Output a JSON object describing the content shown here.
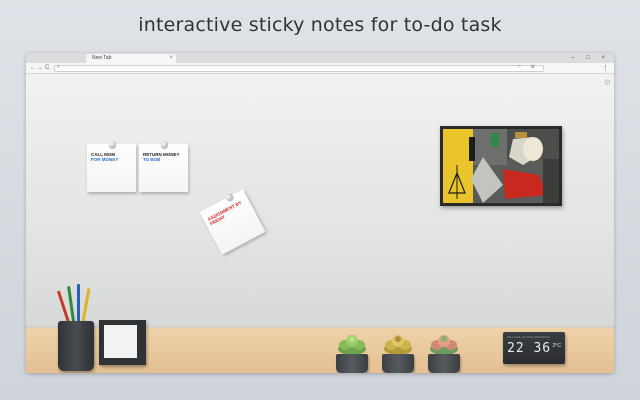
{
  "headline": "interactive sticky notes for to-do task",
  "browser": {
    "tab_title": "New Tab",
    "tab_close": "×",
    "window_controls": "– □ ×",
    "nav_back": "←",
    "nav_forward": "→",
    "nav_reload": "C",
    "omnibox_placeholder": "",
    "omnibox_left_icon": "search-icon",
    "omnibox_right_icons": "☆ ⊕",
    "menu_icon": "⋮"
  },
  "page": {
    "settings_icon": "⚙",
    "notes": [
      {
        "line1": "CALL MOM",
        "line2": "FOR MONEY"
      },
      {
        "line1": "RETURN MONEY",
        "line2": "TO BOB"
      },
      {
        "line1": "ASSIGNMENT BY",
        "line2": "FRIDAY"
      }
    ],
    "clock": {
      "brand": "VILLAGE CLOCK MORNING",
      "time": "22 36",
      "temp": "2°C"
    }
  },
  "colors": {
    "note_accent_blue": "#2a6fc9",
    "note_accent_red": "#dd2222",
    "desk": "#e8c89c",
    "desk_object": "#3a3e42"
  }
}
